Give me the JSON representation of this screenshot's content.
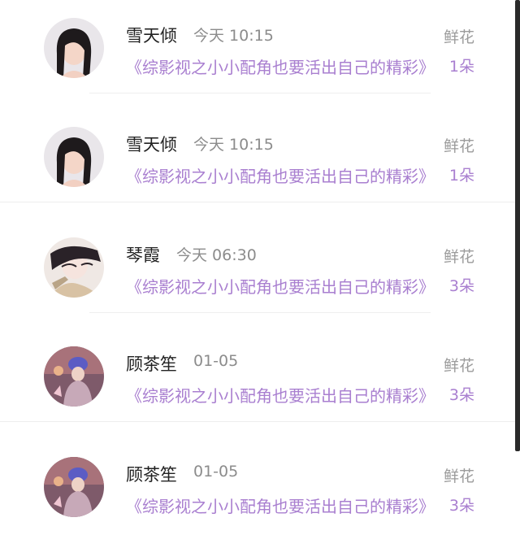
{
  "items": [
    {
      "name": "雪天倾",
      "time": "今天 10:15",
      "title": "《综影视之小小配角也要活出自己的精彩》",
      "gift": "鲜花",
      "count": "1朵",
      "avatar": "woman-portrait-icon"
    },
    {
      "name": "雪天倾",
      "time": "今天 10:15",
      "title": "《综影视之小小配角也要活出自己的精彩》",
      "gift": "鲜花",
      "count": "1朵",
      "avatar": "woman-portrait-icon"
    },
    {
      "name": "琴霞",
      "time": "今天 06:30",
      "title": "《综影视之小小配角也要活出自己的精彩》",
      "gift": "鲜花",
      "count": "3朵",
      "avatar": "anime-portrait-icon"
    },
    {
      "name": "顾茶笙",
      "time": "01-05",
      "title": "《综影视之小小配角也要活出自己的精彩》",
      "gift": "鲜花",
      "count": "3朵",
      "avatar": "illustration-portrait-icon"
    },
    {
      "name": "顾茶笙",
      "time": "01-05",
      "title": "《综影视之小小配角也要活出自己的精彩》",
      "gift": "鲜花",
      "count": "3朵",
      "avatar": "illustration-portrait-icon"
    }
  ]
}
